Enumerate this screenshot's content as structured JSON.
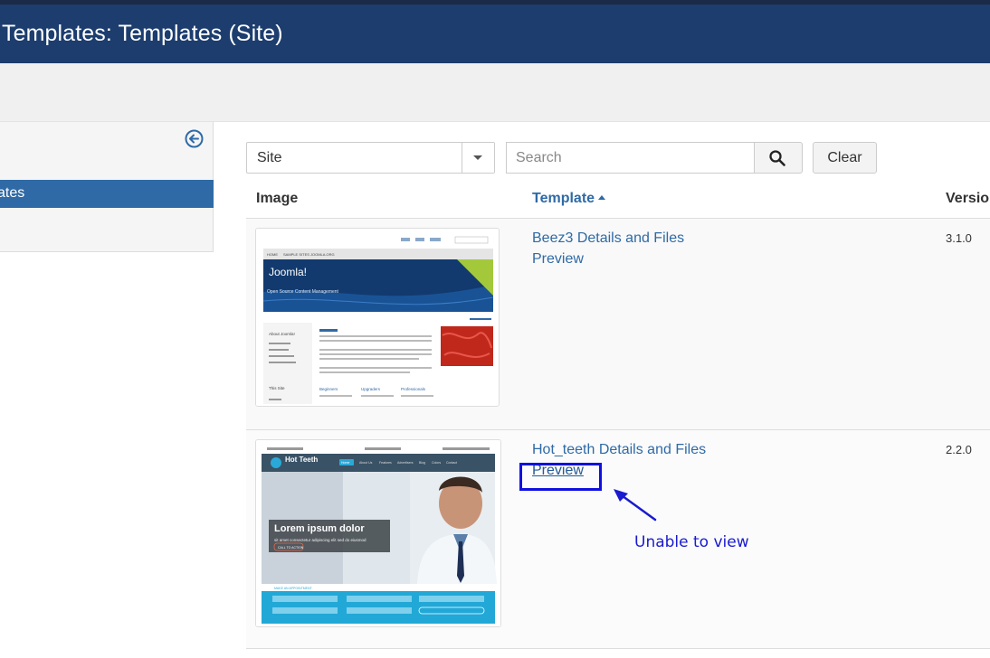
{
  "header": {
    "title": "Templates: Templates (Site)"
  },
  "sidebar": {
    "active_item": "ates"
  },
  "filters": {
    "client_select": "Site",
    "search_placeholder": "Search",
    "clear_label": "Clear"
  },
  "table": {
    "columns": {
      "image": "Image",
      "template": "Template",
      "version": "Versio"
    },
    "rows": [
      {
        "details": "Beez3 Details and Files",
        "preview": "Preview",
        "version": "3.1.0"
      },
      {
        "details": "Hot_teeth Details and Files",
        "preview": "Preview",
        "version": "2.2.0"
      }
    ]
  },
  "thumb_beez": {
    "topnav": [
      "HOME",
      "SAMPLE SITES",
      "JOOMLA.ORG"
    ],
    "brand": "Joomla!",
    "tagline": "Open Source Content Management",
    "about": "About Joomla!",
    "this_site": "This Site",
    "col_beginners": "Beginners",
    "col_upgraders": "Upgraders",
    "col_professionals": "Professionals"
  },
  "thumb_hot": {
    "brand": "Hot Teeth",
    "nav": [
      "Home",
      "About Us",
      "Features",
      "Advertisers",
      "Blog",
      "Colors",
      "Contact"
    ],
    "hero_title": "Lorem ipsum dolor",
    "hero_sub": "sit amet consectetur adipiscing elit sed do eiusmod",
    "cta": "CALL TO ACTION",
    "appointment": "MAKE AN APPOINTMENT"
  },
  "annotation": {
    "text": "Unable to view"
  },
  "colors": {
    "header": "#1c3d6e",
    "accent": "#2f6aa6",
    "annotation": "#1010e0"
  }
}
